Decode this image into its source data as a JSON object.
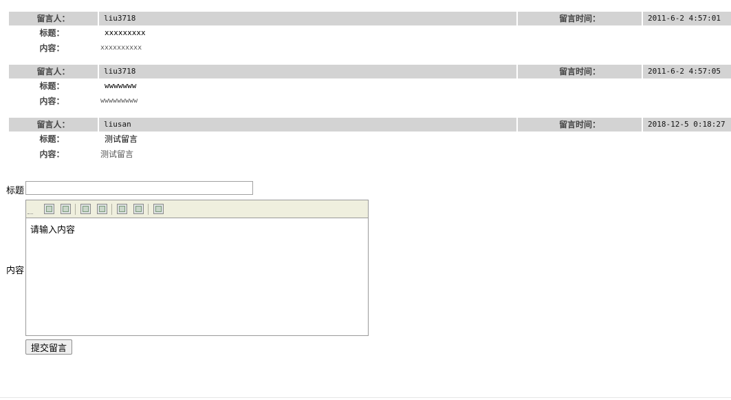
{
  "labels": {
    "author": "留言人：",
    "time": "留言时间：",
    "title": "标题：",
    "content": "内容："
  },
  "messages": [
    {
      "author": "liu3718",
      "time": "2011-6-2 4:57:01",
      "title": "xxxxxxxxx",
      "content": "xxxxxxxxxx"
    },
    {
      "author": "liu3718",
      "time": "2011-6-2 4:57:05",
      "title": "wwwwwww",
      "content": "wwwwwwwww"
    },
    {
      "author": "liusan",
      "time": "2018-12-5 0:18:27",
      "title": "测试留言",
      "content": "测试留言"
    }
  ],
  "form": {
    "title_label": "标题",
    "title_value": "",
    "content_label": "内容",
    "content_placeholder": "请输入内容",
    "submit_label": "提交留言"
  },
  "toolbar": {
    "buttons": [
      "image-icon",
      "image-icon",
      "film-icon",
      "film-icon",
      "media-icon",
      "media-icon",
      "image-icon"
    ]
  }
}
